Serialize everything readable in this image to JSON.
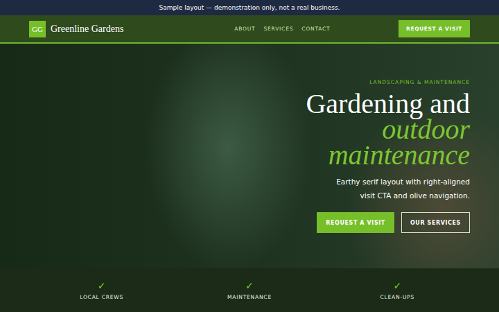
{
  "banner": {
    "text": "Sample layout — demonstration only, not a real business."
  },
  "header": {
    "logo": "GG",
    "brand": "Greenline Gardens",
    "nav": [
      "ABOUT",
      "SERVICES",
      "CONTACT"
    ],
    "cta": "REQUEST A VISIT"
  },
  "hero": {
    "eyebrow": "LANDSCAPING & MAINTENANCE",
    "title": "Gardening and",
    "title_accent": "outdoor maintenance",
    "text": "Earthy serif layout with right-aligned visit CTA and olive navigation.",
    "primary": "REQUEST A VISIT",
    "secondary": "OUR SERVICES"
  },
  "features": [
    {
      "icon": "✓",
      "label": "LOCAL CREWS"
    },
    {
      "icon": "✓",
      "label": "MAINTENANCE"
    },
    {
      "icon": "✓",
      "label": "CLEAN-UPS"
    }
  ]
}
